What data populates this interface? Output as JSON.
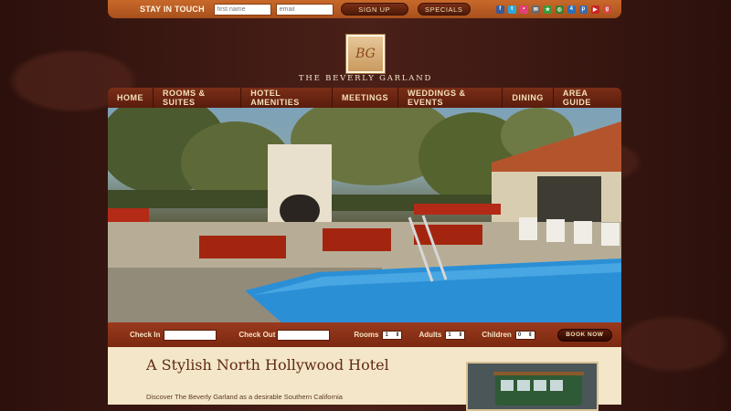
{
  "topbar": {
    "stay_in_touch": "STAY IN TOUCH",
    "first_name_placeholder": "first name",
    "email_placeholder": "email",
    "signup_label": "SIGN UP",
    "specials_label": "SPECIALS",
    "social_icons": [
      "facebook-icon",
      "twitter-icon",
      "flickr-icon",
      "email-icon",
      "yelp-icon",
      "tripadvisor-icon",
      "foursquare-icon",
      "pinterest-icon",
      "youtube-icon",
      "google-plus-icon"
    ]
  },
  "brand": {
    "name": "THE BEVERLY GARLAND",
    "monogram": "BG"
  },
  "nav": [
    {
      "label": "HOME"
    },
    {
      "label": "ROOMS & SUITES"
    },
    {
      "label": "HOTEL AMENITIES"
    },
    {
      "label": "MEETINGS"
    },
    {
      "label": "WEDDINGS & EVENTS"
    },
    {
      "label": "DINING"
    },
    {
      "label": "AREA GUIDE"
    }
  ],
  "booking": {
    "check_in_label": "Check In",
    "check_out_label": "Check Out",
    "rooms_label": "Rooms",
    "rooms_value": "1",
    "adults_label": "Adults",
    "adults_value": "1",
    "children_label": "Children",
    "children_value": "0",
    "book_now_label": "BOOK NOW"
  },
  "content": {
    "heading": "A Stylish North Hollywood Hotel",
    "intro": "Discover The Beverly Garland as a desirable Southern California"
  },
  "colors": {
    "accent_orange": "#c8692b",
    "nav_brown": "#7a2e17",
    "booking_red": "#9a3a1e",
    "cream": "#f4e6c8",
    "heading_brown": "#5e2a13"
  }
}
